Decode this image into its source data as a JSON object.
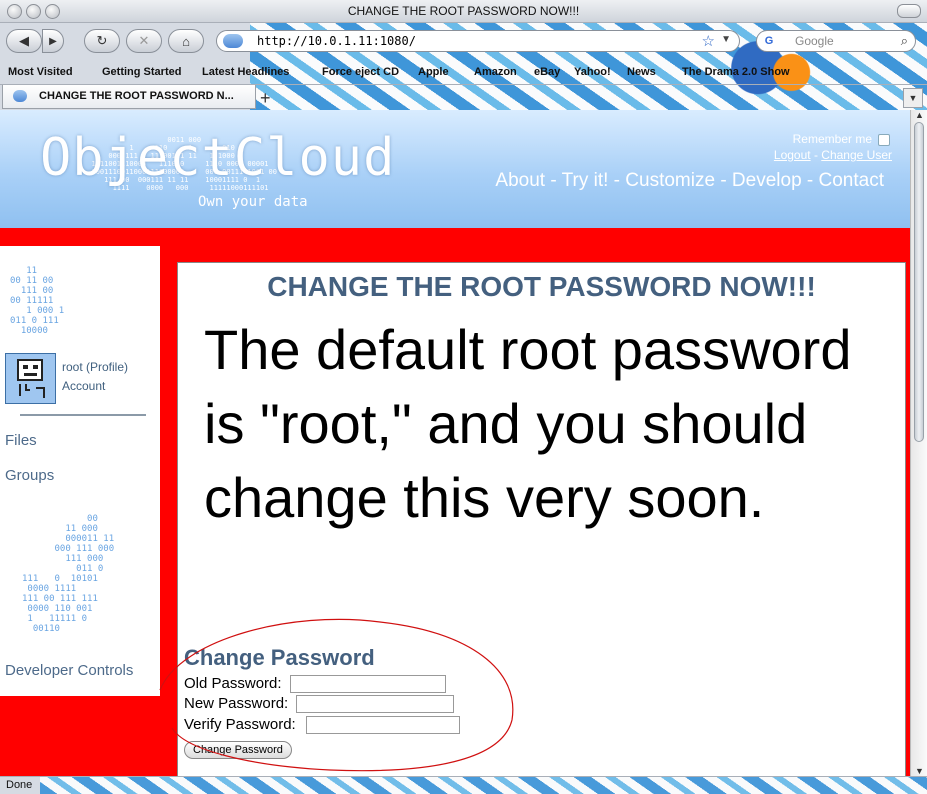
{
  "window": {
    "title": "CHANGE THE ROOT PASSWORD NOW!!!"
  },
  "toolbar": {
    "url": "http://10.0.1.11:1080/",
    "search_placeholder": "Google"
  },
  "bookmarks": [
    "Most Visited",
    "Getting Started",
    "Latest Headlines",
    "Force eject CD",
    "Apple",
    "Amazon",
    "eBay",
    "Yahoo!",
    "News",
    "The Drama 2.0 Show"
  ],
  "tab": {
    "label": "CHANGE THE ROOT PASSWORD N..."
  },
  "header": {
    "logo": "ObjectCloud",
    "tagline": "Own your data",
    "remember_label": "Remember me",
    "logout": "Logout",
    "separator": " - ",
    "change_user": "Change User",
    "nav": "About - Try it! - Customize - Develop - Contact"
  },
  "sidebar": {
    "profile_link": "root (Profile)",
    "account_link": "Account",
    "files": "Files",
    "groups": "Groups",
    "developer_controls": "Developer Controls"
  },
  "main": {
    "headline": "CHANGE THE ROOT PASSWORD NOW!!!",
    "message": "The default root password is \"root,\" and you should change this very soon."
  },
  "form": {
    "title": "Change Password",
    "old_label": "Old Password:",
    "new_label": "New Password:",
    "verify_label": "Verify Password:",
    "button": "Change Password"
  },
  "status": {
    "text": "Done"
  }
}
